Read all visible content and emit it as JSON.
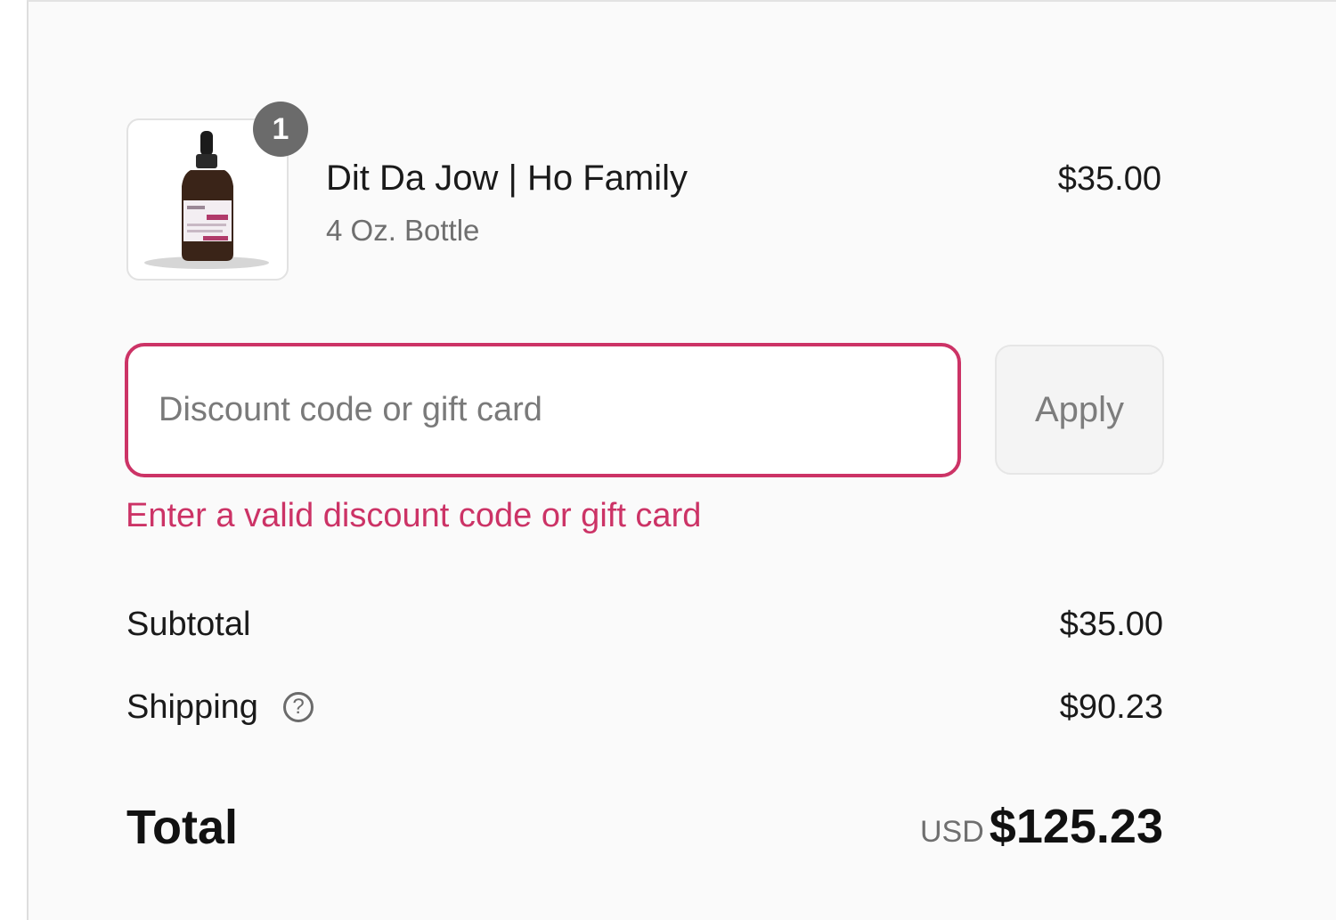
{
  "cart": {
    "item": {
      "quantity": "1",
      "name": "Dit Da Jow | Ho Family",
      "variant": "4 Oz. Bottle",
      "price": "$35.00",
      "image_icon": "dropper-bottle-icon"
    }
  },
  "discount": {
    "placeholder": "Discount code or gift card",
    "value": "",
    "apply_label": "Apply",
    "error": "Enter a valid discount code or gift card"
  },
  "summary": {
    "subtotal_label": "Subtotal",
    "subtotal_value": "$35.00",
    "shipping_label": "Shipping",
    "shipping_value": "$90.23",
    "help_icon": "question-circle-icon",
    "total_label": "Total",
    "currency": "USD",
    "total_value": "$125.23"
  },
  "colors": {
    "error": "#cc3366",
    "badge": "#6b6b6b"
  }
}
